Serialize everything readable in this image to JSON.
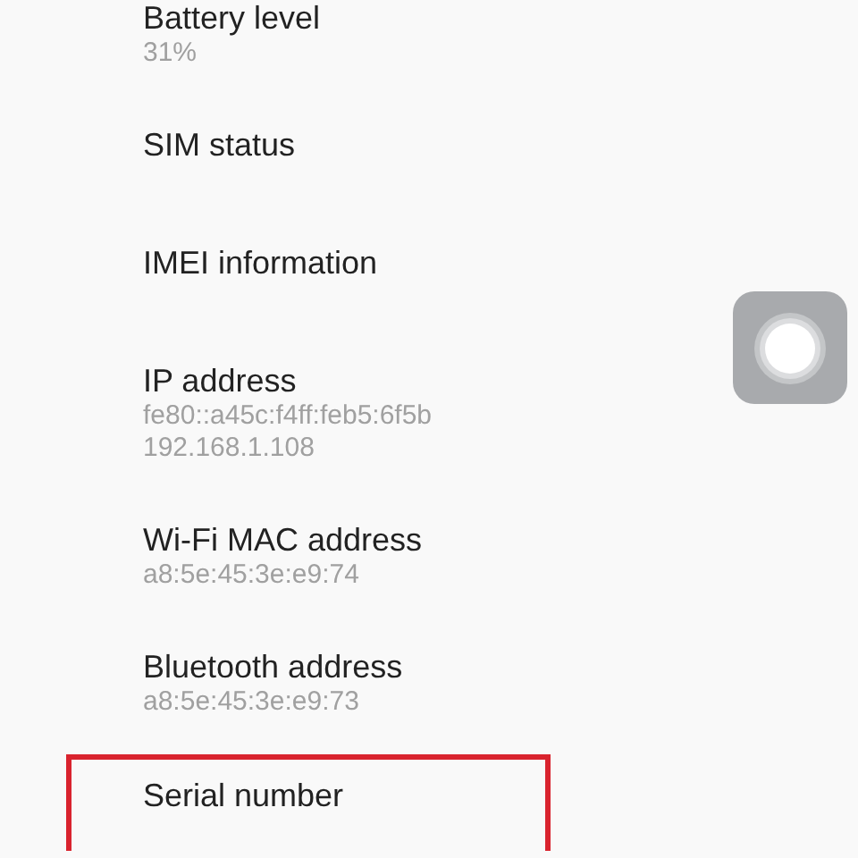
{
  "items": [
    {
      "title": "Battery level",
      "values": [
        "31%"
      ],
      "highlighted": false
    },
    {
      "title": "SIM status",
      "highlighted": false
    },
    {
      "title": "IMEI information",
      "highlighted": false
    },
    {
      "title": "IP address",
      "values": [
        "fe80::a45c:f4ff:feb5:6f5b",
        "192.168.1.108"
      ],
      "highlighted": false
    },
    {
      "title": "Wi-Fi MAC address",
      "values": [
        "a8:5e:45:3e:e9:74"
      ],
      "highlighted": false
    },
    {
      "title": "Bluetooth address",
      "values": [
        "a8:5e:45:3e:e9:73"
      ],
      "highlighted": false
    },
    {
      "title": "Serial number",
      "highlighted": true
    }
  ]
}
